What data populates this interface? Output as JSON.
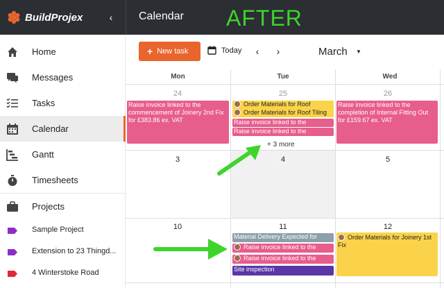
{
  "app": {
    "brand": "BuildProjex",
    "page_title": "Calendar",
    "overlay_label": "AFTER"
  },
  "sidebar": {
    "items": [
      {
        "label": "Home",
        "icon": "home-icon"
      },
      {
        "label": "Messages",
        "icon": "messages-icon"
      },
      {
        "label": "Tasks",
        "icon": "tasks-icon"
      },
      {
        "label": "Calendar",
        "icon": "calendar-icon",
        "active": true
      },
      {
        "label": "Gantt",
        "icon": "gantt-icon"
      },
      {
        "label": "Timesheets",
        "icon": "stopwatch-icon"
      },
      {
        "label": "Projects",
        "icon": "briefcase-icon"
      }
    ],
    "projects": [
      {
        "label": "Sample Project",
        "color": "#8e2dc5"
      },
      {
        "label": "Extension to 23 Thingd...",
        "color": "#8e2dc5"
      },
      {
        "label": "4 Winterstoke Road",
        "color": "#e0283a"
      }
    ]
  },
  "toolbar": {
    "new_task": "New task",
    "today": "Today",
    "month": "March"
  },
  "calendar": {
    "weekdays": [
      "Mon",
      "Tue",
      "Wed"
    ],
    "week1": {
      "days": [
        "24",
        "25",
        "26"
      ]
    },
    "week2": {
      "days": [
        "3",
        "4",
        "5"
      ]
    },
    "week3": {
      "days": [
        "10",
        "11",
        "12"
      ]
    },
    "more_label": "+ 3 more",
    "events": {
      "mon24": "Raise invoice linked to the commencement of Joinery 2nd Fix for £383.86 ex. VAT",
      "tue25_1": "Order Materials for Roof",
      "tue25_2": "Order Materials for Roof Tiling",
      "tue25_3": "Raise invoice linked to the",
      "tue25_4": "Raise invoice linked to the",
      "wed26": "Raise invoice linked to the completion of Internal Fitting Out for £159.67 ex. VAT",
      "tue11_1": "Material Delivery Expected for",
      "tue11_2": "Raise invoice linked to the",
      "tue11_3": "Raise invoice linked to the",
      "tue11_4": "Site inspection",
      "wed12": "Order Materials for Joinery 1st Fix"
    }
  },
  "colors": {
    "accent": "#e8652c",
    "topbar": "#2b2e33",
    "event_pink": "#e75d8b",
    "event_yellow": "#fad34a",
    "event_grey": "#8aa0ab",
    "event_purple": "#5a36a6",
    "annotation_green": "#3fd42c"
  }
}
